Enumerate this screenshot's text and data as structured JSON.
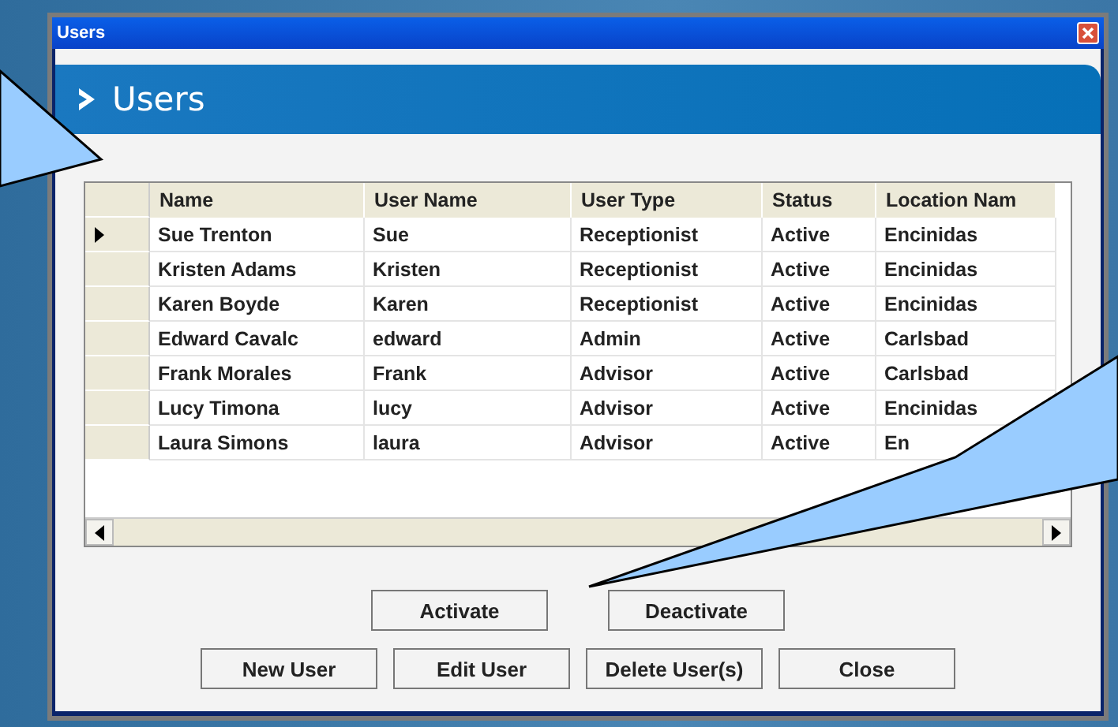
{
  "window": {
    "title": "Users"
  },
  "header": {
    "title": "Users"
  },
  "table": {
    "columns": [
      "Name",
      "User Name",
      "User Type",
      "Status",
      "Location Nam"
    ],
    "rows": [
      {
        "selected": true,
        "cells": [
          "Sue Trenton",
          "Sue",
          "Receptionist",
          "Active",
          "Encinidas"
        ]
      },
      {
        "selected": false,
        "cells": [
          "Kristen Adams",
          "Kristen",
          "Receptionist",
          "Active",
          "Encinidas"
        ]
      },
      {
        "selected": false,
        "cells": [
          "Karen Boyde",
          "Karen",
          "Receptionist",
          "Active",
          "Encinidas"
        ]
      },
      {
        "selected": false,
        "cells": [
          "Edward Cavalc",
          "edward",
          "Admin",
          "Active",
          "Carlsbad"
        ]
      },
      {
        "selected": false,
        "cells": [
          "Frank Morales",
          "Frank",
          "Advisor",
          "Active",
          "Carlsbad"
        ]
      },
      {
        "selected": false,
        "cells": [
          "Lucy Timona",
          "lucy",
          "Advisor",
          "Active",
          "Encinidas"
        ]
      },
      {
        "selected": false,
        "cells": [
          "Laura Simons",
          "laura",
          "Advisor",
          "Active",
          "En"
        ]
      }
    ]
  },
  "button_rows": [
    [
      "Activate",
      "Deactivate"
    ],
    [
      "New User",
      "Edit User",
      "Delete User(s)",
      "Close"
    ]
  ]
}
